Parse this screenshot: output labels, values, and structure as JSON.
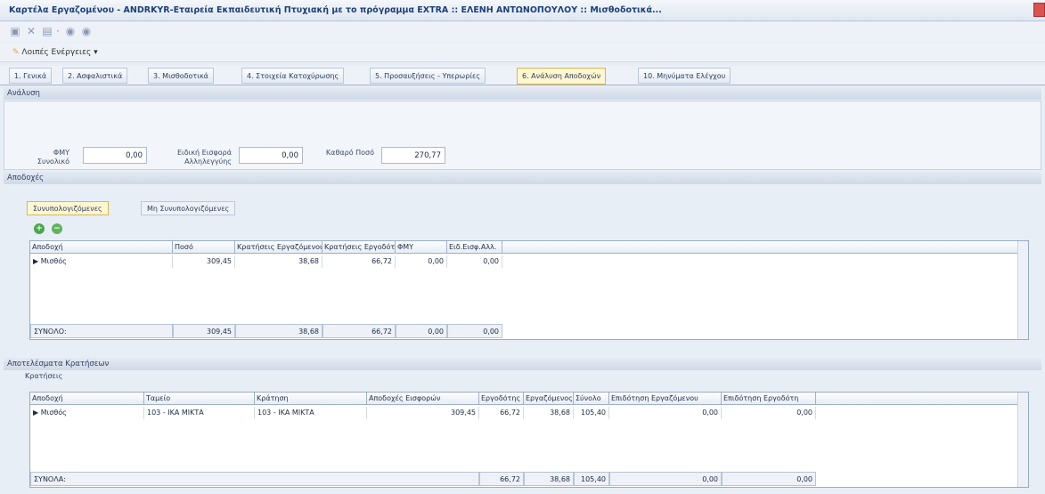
{
  "window": {
    "title": "Καρτέλα Εργαζομένου - ANDRKYR-Εταιρεία Εκπαιδευτική Πτυχιακή με το πρόγραμμα EXTRA :: ΕΛΕΝΗ ΑΝΤΩΝΟΠΟΥΛΟΥ :: Μισθοδοτικά..."
  },
  "actions": {
    "label": "Λοιπές Ενέργειες",
    "arrow": "▾"
  },
  "tabs": [
    {
      "label": "1. Γενικά"
    },
    {
      "label": "2. Ασφαλιστικά"
    },
    {
      "label": "3. Μισθοδοτικά"
    },
    {
      "label": "4. Στοιχεία Κατοχύρωσης"
    },
    {
      "label": "5. Προσαυξήσεις - Υπερωρίες"
    },
    {
      "label": "6. Ανάλυση Αποδοχών"
    },
    {
      "label": "10. Μηνύματα Ελέγχου"
    }
  ],
  "analysis": {
    "header": "Ανάλυση",
    "fmy_label": "ΦΜΥ Συνολικό",
    "fmy_value": "0,00",
    "eek_label": "Ειδική Εισφορά Αλληλεγγύης",
    "eek_value": "0,00",
    "net_label": "Καθαρό Ποσό",
    "net_value": "270,77"
  },
  "earnings": {
    "header": "Αποδοχές",
    "subtabs": [
      "Συνυπολογιζόμενες",
      "Μη Συνυπολογιζόμενες"
    ],
    "columns": [
      "Αποδοχή",
      "Ποσό",
      "Κρατήσεις Εργαζόμενου",
      "Κρατήσεις Εργοδότη",
      "ΦΜΥ",
      "Ειδ.Εισφ.Αλλ."
    ],
    "rows": [
      {
        "name": "Μισθός",
        "amount": "309,45",
        "emp": "38,68",
        "empl": "66,72",
        "fmy": "0,00",
        "eek": "0,00"
      }
    ],
    "totals": {
      "label": "ΣΥΝΟΛΟ:",
      "amount": "309,45",
      "emp": "38,68",
      "empl": "66,72",
      "fmy": "0,00",
      "eek": "0,00"
    }
  },
  "deductions": {
    "header": "Αποτελέσματα Κρατήσεων",
    "subheader": "Κρατήσεις",
    "columns": [
      "Αποδοχή",
      "Ταμείο",
      "Κράτηση",
      "Αποδοχές Εισφορών",
      "Εργοδότης",
      "Εργαζόμενος",
      "Σύνολο",
      "Επιδότηση Εργαζόμενου",
      "Επιδότηση Εργοδότη"
    ],
    "rows": [
      {
        "name": "Μισθός",
        "fund": "103 - ΙΚΑ ΜΙΚΤΑ",
        "ded": "103 - ΙΚΑ ΜΙΚΤΑ",
        "base": "309,45",
        "empl": "66,72",
        "emp": "38,68",
        "total": "105,40",
        "sub_emp": "0,00",
        "sub_empl": "0,00"
      }
    ],
    "totals": {
      "label": "ΣΥΝΟΛΑ:",
      "empl": "66,72",
      "emp": "38,68",
      "total": "105,40",
      "sub_emp": "0,00",
      "sub_empl": "0,00"
    }
  },
  "colors": {
    "accent": "#1d3f78",
    "active_tab": "#fff6d2",
    "header_bg": "#cfd9e7",
    "add_icon": "#4aa84a"
  }
}
